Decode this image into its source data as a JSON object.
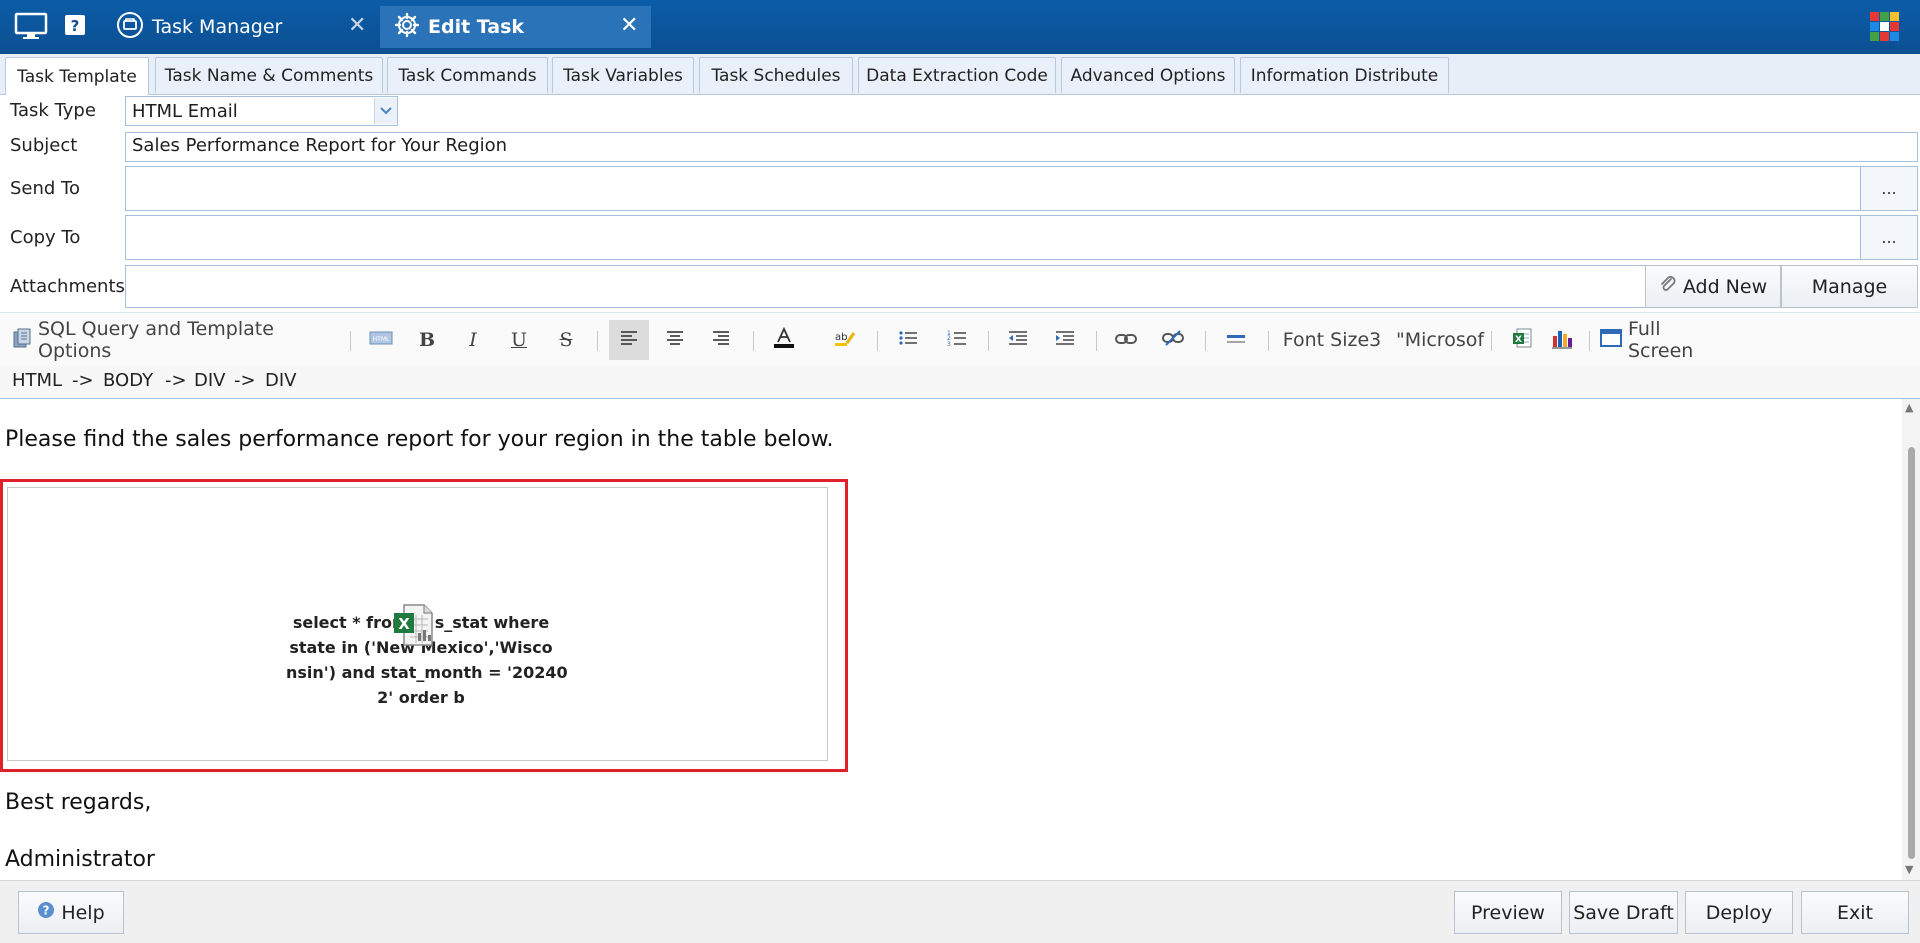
{
  "titlebar": {
    "tabs": [
      {
        "label": "Task Manager",
        "icon": "task-manager-icon"
      },
      {
        "label": "Edit Task",
        "icon": "gear-icon"
      }
    ]
  },
  "editor_tabs": [
    "Task Template",
    "Task Name & Comments",
    "Task Commands",
    "Task Variables",
    "Task Schedules",
    "Data Extraction Code",
    "Advanced Options",
    "Information Distribute"
  ],
  "form": {
    "task_type_label": "Task Type",
    "task_type_value": "HTML Email",
    "subject_label": "Subject",
    "subject_value": "Sales Performance Report for Your Region",
    "send_to_label": "Send To",
    "send_to_value": "",
    "copy_to_label": "Copy To",
    "copy_to_value": "",
    "attachments_label": "Attachments",
    "browse_label": "...",
    "add_new_label": "Add New",
    "manage_label": "Manage"
  },
  "toolbar": {
    "sql_label": "SQL Query and Template Options",
    "font_size_label": "Font Size3",
    "font_name_label": "\"Microsof",
    "full_screen_label": "Full Screen"
  },
  "path": [
    "HTML",
    "->",
    "BODY",
    "->",
    "DIV",
    "->",
    "DIV"
  ],
  "content": {
    "intro": "Please find the sales performance report for your region in the table below.",
    "sql_lines": [
      "select * from",
      "s_stat where",
      "state in ('New Mexico','Wisco",
      "nsin') and stat_month = '20240",
      "2' order b"
    ],
    "regards": "Best regards,",
    "signature": "Administrator"
  },
  "footer": {
    "help_label": "Help",
    "preview_label": "Preview",
    "save_draft_label": "Save Draft",
    "deploy_label": "Deploy",
    "exit_label": "Exit"
  },
  "colors": {
    "titlebar": "#0d4f92",
    "highlight_border": "#e0202a",
    "accent": "#4a84c4"
  }
}
